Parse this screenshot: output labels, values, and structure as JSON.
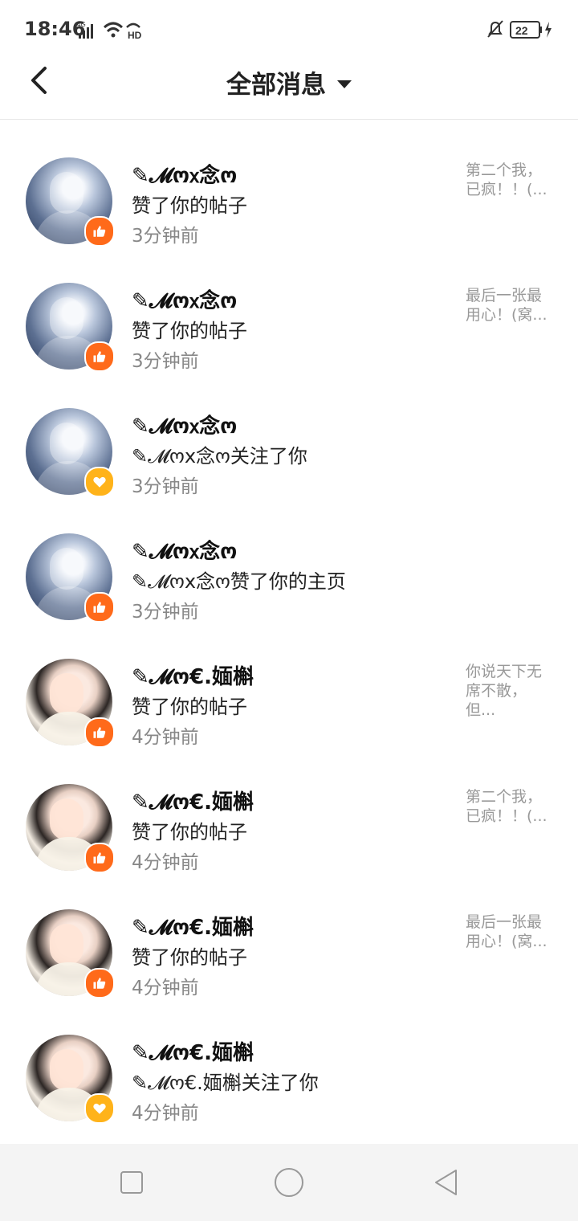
{
  "status_bar": {
    "time": "18:46",
    "network_label": "4G",
    "hd_label": "HD",
    "battery_level": "22",
    "icons": [
      "signal-icon",
      "wifi-icon",
      "hd-icon",
      "mute-bell-icon",
      "battery-icon",
      "charging-icon"
    ]
  },
  "header": {
    "title": "全部消息",
    "back_icon": "chevron-left-icon",
    "dropdown_icon": "caret-down-icon"
  },
  "messages": [
    {
      "name": "✎𝓜ო𝗑念ო",
      "action": "赞了你的帖子",
      "time": "3分钟前",
      "preview": "第二个我，\n已疯！！(...",
      "badge": "like",
      "avatar": "blue"
    },
    {
      "name": "✎𝓜ო𝗑念ო",
      "action": "赞了你的帖子",
      "time": "3分钟前",
      "preview": "最后一张最\n用心！(窝...",
      "badge": "like",
      "avatar": "blue"
    },
    {
      "name": "✎𝓜ო𝗑念ო",
      "action": "✎𝓜ოx念ო关注了你",
      "time": "3分钟前",
      "preview": "",
      "badge": "follow",
      "avatar": "blue"
    },
    {
      "name": "✎𝓜ო𝗑念ო",
      "action": "✎𝓜ოx念ო赞了你的主页",
      "time": "3分钟前",
      "preview": "",
      "badge": "like",
      "avatar": "blue"
    },
    {
      "name": "✎𝓜ო€.媔槲",
      "action": "赞了你的帖子",
      "time": "4分钟前",
      "preview": "你说天下无\n席不散，\n但...",
      "badge": "like",
      "avatar": "girl"
    },
    {
      "name": "✎𝓜ო€.媔槲",
      "action": "赞了你的帖子",
      "time": "4分钟前",
      "preview": "第二个我，\n已疯！！(...",
      "badge": "like",
      "avatar": "girl"
    },
    {
      "name": "✎𝓜ო€.媔槲",
      "action": "赞了你的帖子",
      "time": "4分钟前",
      "preview": "最后一张最\n用心！(窝...",
      "badge": "like",
      "avatar": "girl"
    },
    {
      "name": "✎𝓜ო€.媔槲",
      "action": "✎𝓜ო€.媔槲关注了你",
      "time": "4分钟前",
      "preview": "",
      "badge": "follow",
      "avatar": "girl"
    }
  ],
  "nav_bar": {
    "icons": [
      "recent-apps-icon",
      "home-icon",
      "back-icon"
    ]
  },
  "colors": {
    "like_badge": "#ff6a1a",
    "follow_badge": "#ffb31a",
    "time_text": "#888888",
    "preview_text": "#999999"
  }
}
